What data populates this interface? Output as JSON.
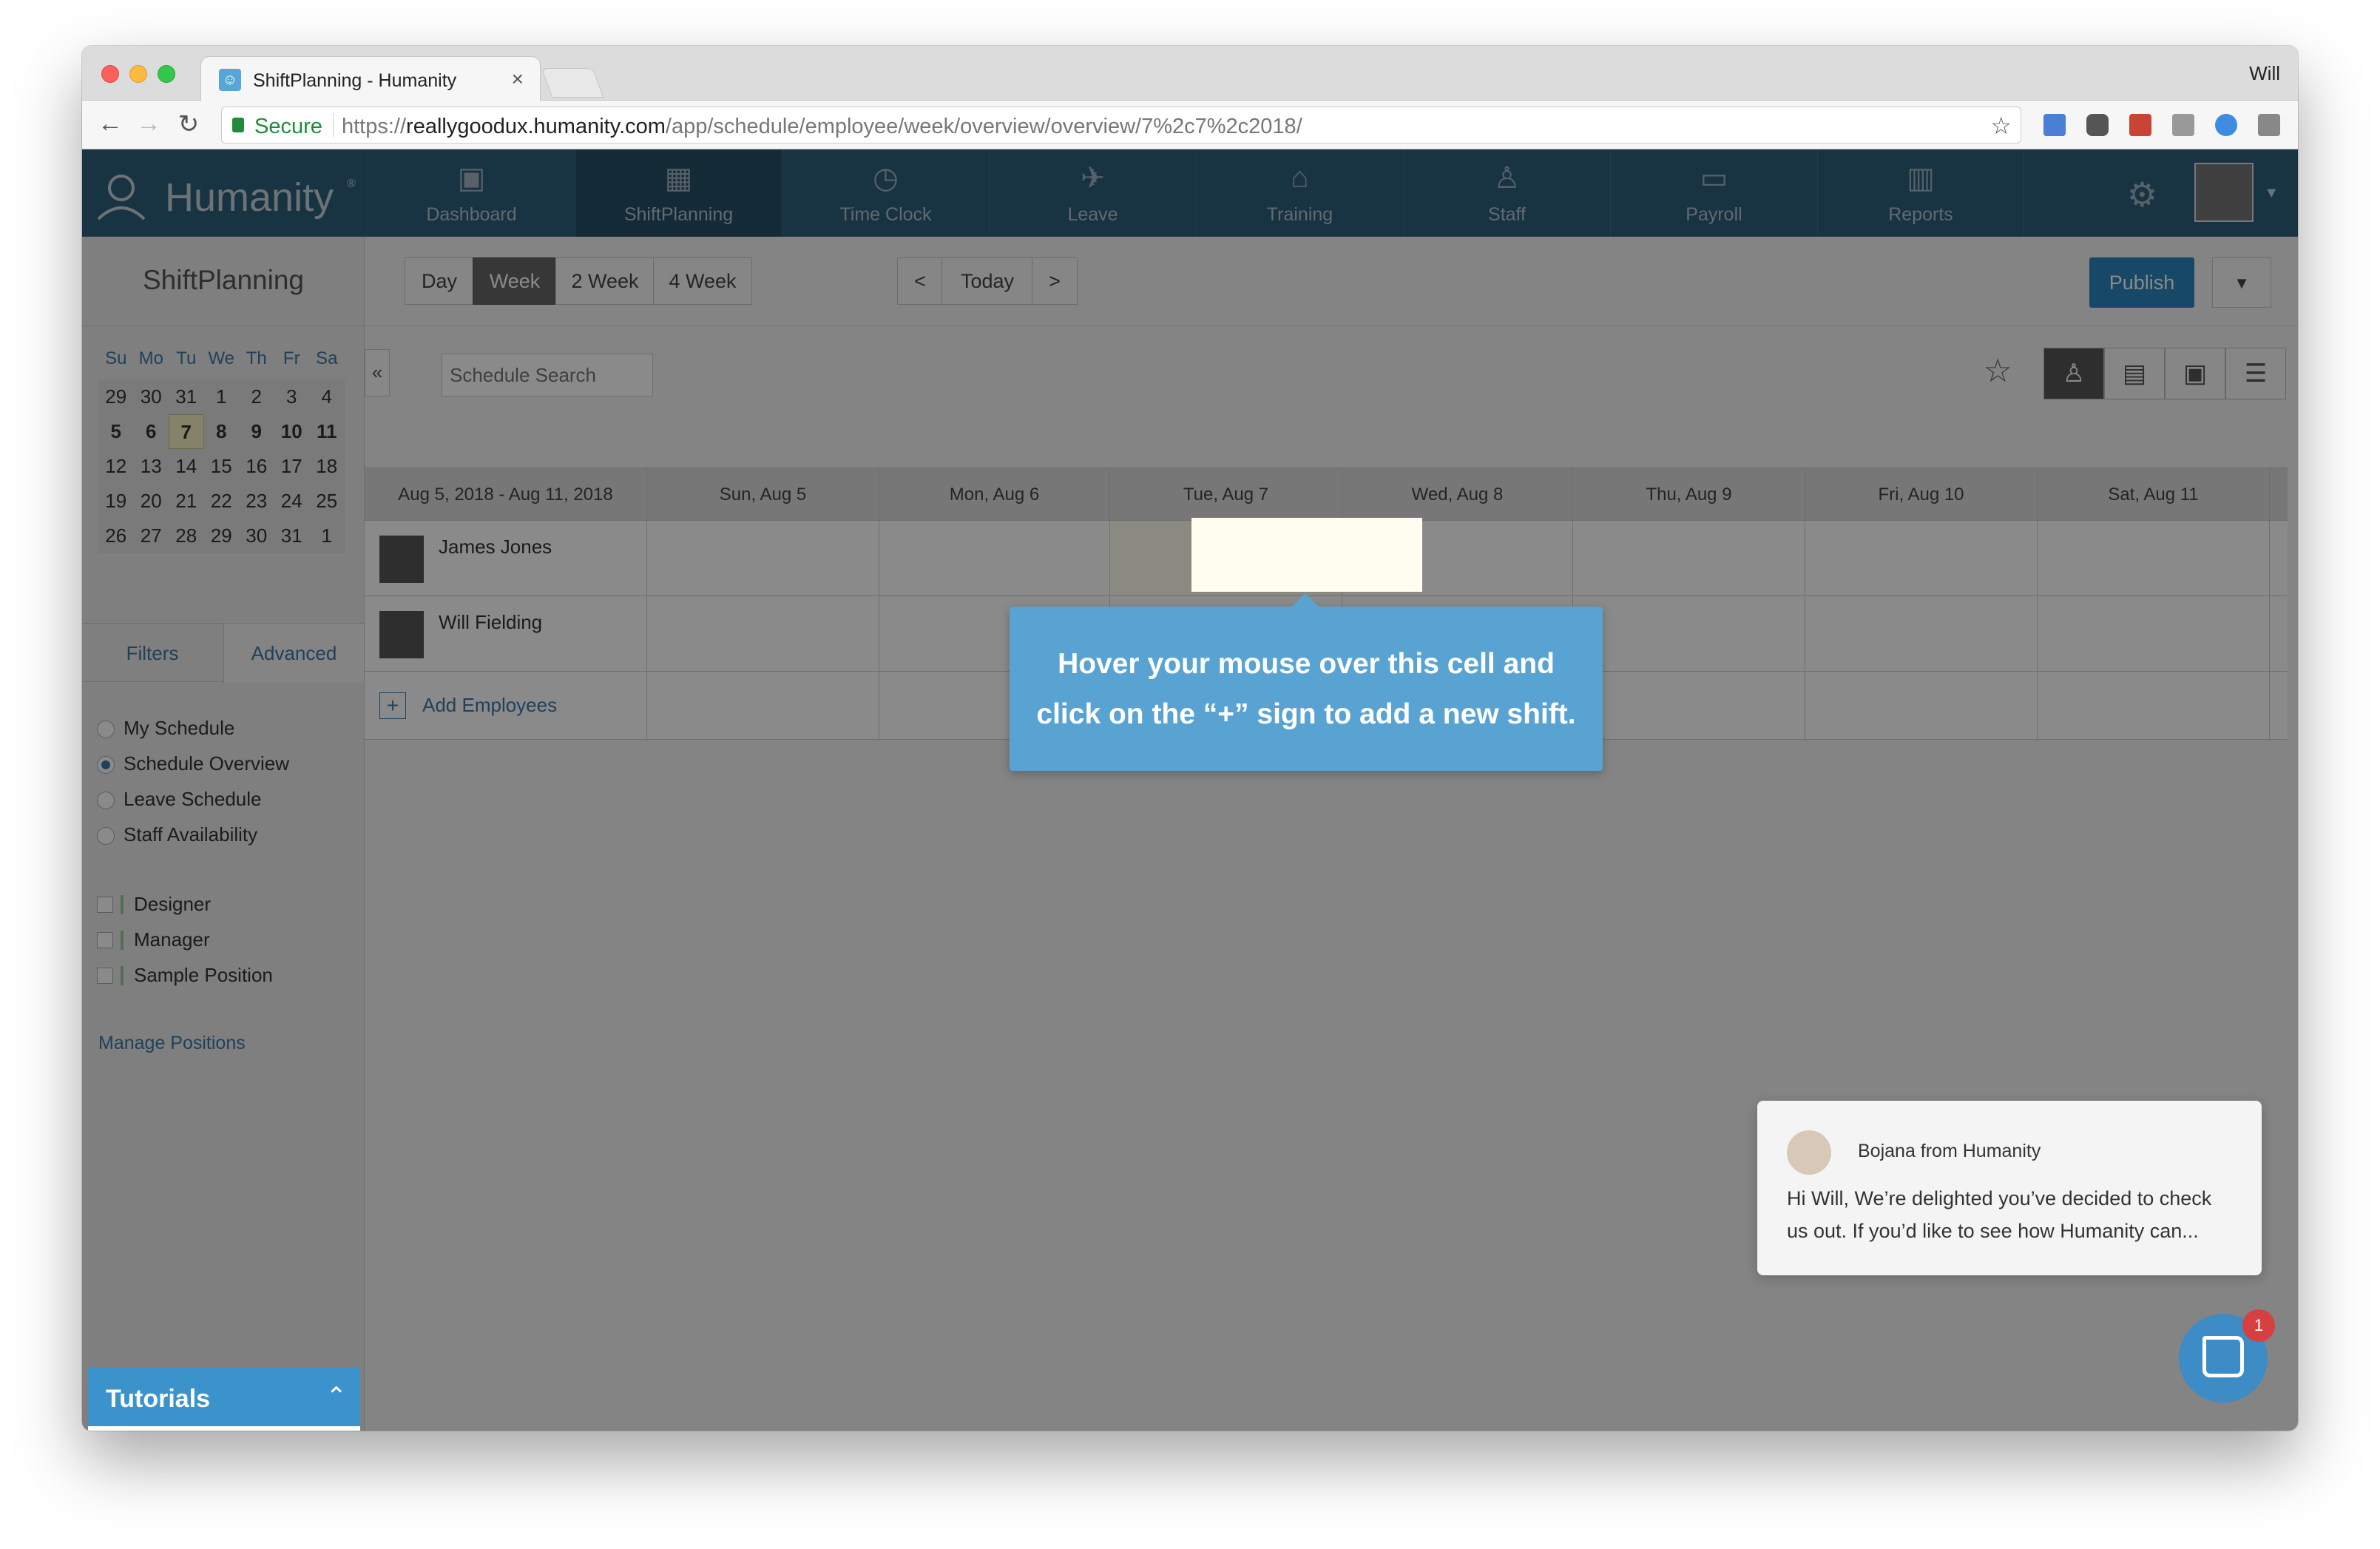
{
  "browser": {
    "tab_title": "ShiftPlanning - Humanity",
    "profile_name": "Will",
    "secure_label": "Secure",
    "url_scheme": "https://",
    "url_host": "reallygoodux.humanity.com",
    "url_path": "/app/schedule/employee/week/overview/overview/7%2c7%2c2018/"
  },
  "app": {
    "logo_text": "Humanity",
    "logo_reg": "®",
    "nav": [
      {
        "label": "Dashboard",
        "icon": "dashboard-icon"
      },
      {
        "label": "ShiftPlanning",
        "icon": "shiftplanning-icon"
      },
      {
        "label": "Time Clock",
        "icon": "time-clock-icon"
      },
      {
        "label": "Leave",
        "icon": "leave-icon"
      },
      {
        "label": "Training",
        "icon": "training-icon"
      },
      {
        "label": "Staff",
        "icon": "staff-icon"
      },
      {
        "label": "Payroll",
        "icon": "payroll-icon"
      },
      {
        "label": "Reports",
        "icon": "reports-icon"
      }
    ]
  },
  "sidebar": {
    "title": "ShiftPlanning",
    "calendar": {
      "days": [
        "Su",
        "Mo",
        "Tu",
        "We",
        "Th",
        "Fr",
        "Sa"
      ],
      "weeks": [
        [
          "29",
          "30",
          "31",
          "1",
          "2",
          "3",
          "4"
        ],
        [
          "5",
          "6",
          "7",
          "8",
          "9",
          "10",
          "11"
        ],
        [
          "12",
          "13",
          "14",
          "15",
          "16",
          "17",
          "18"
        ],
        [
          "19",
          "20",
          "21",
          "22",
          "23",
          "24",
          "25"
        ],
        [
          "26",
          "27",
          "28",
          "29",
          "30",
          "31",
          "1"
        ]
      ]
    },
    "tabs": {
      "filters": "Filters",
      "advanced": "Advanced"
    },
    "views": [
      "My Schedule",
      "Schedule Overview",
      "Leave Schedule",
      "Staff Availability"
    ],
    "positions": [
      "Designer",
      "Manager",
      "Sample Position"
    ],
    "manage_positions": "Manage Positions",
    "tutorials": "Tutorials"
  },
  "toolbar": {
    "ranges": [
      "Day",
      "Week",
      "2 Week",
      "4 Week"
    ],
    "prev": "<",
    "today": "Today",
    "next": ">",
    "publish": "Publish",
    "search_placeholder": "Schedule Search"
  },
  "schedule": {
    "range_label": "Aug 5, 2018 - Aug 11, 2018",
    "days": [
      "Sun, Aug 5",
      "Mon, Aug 6",
      "Tue, Aug 7",
      "Wed, Aug 8",
      "Thu, Aug 9",
      "Fri, Aug 10",
      "Sat, Aug 11"
    ],
    "employees": [
      "James Jones",
      "Will Fielding"
    ],
    "add_employees": "Add Employees"
  },
  "tooltip": {
    "line1": "Hover your mouse over this cell and",
    "line2": "click on the “+” sign to add a new shift."
  },
  "chat": {
    "from": "Bojana from Humanity",
    "message": "Hi Will, We’re delighted you’ve decided to check us out. If you’d like to see how Humanity can...",
    "badge": "1"
  },
  "colors": {
    "nav_bg": "#2e5f7a",
    "accent": "#3c78a6",
    "publish": "#2e86c1",
    "tooltip": "#59a3d3"
  }
}
